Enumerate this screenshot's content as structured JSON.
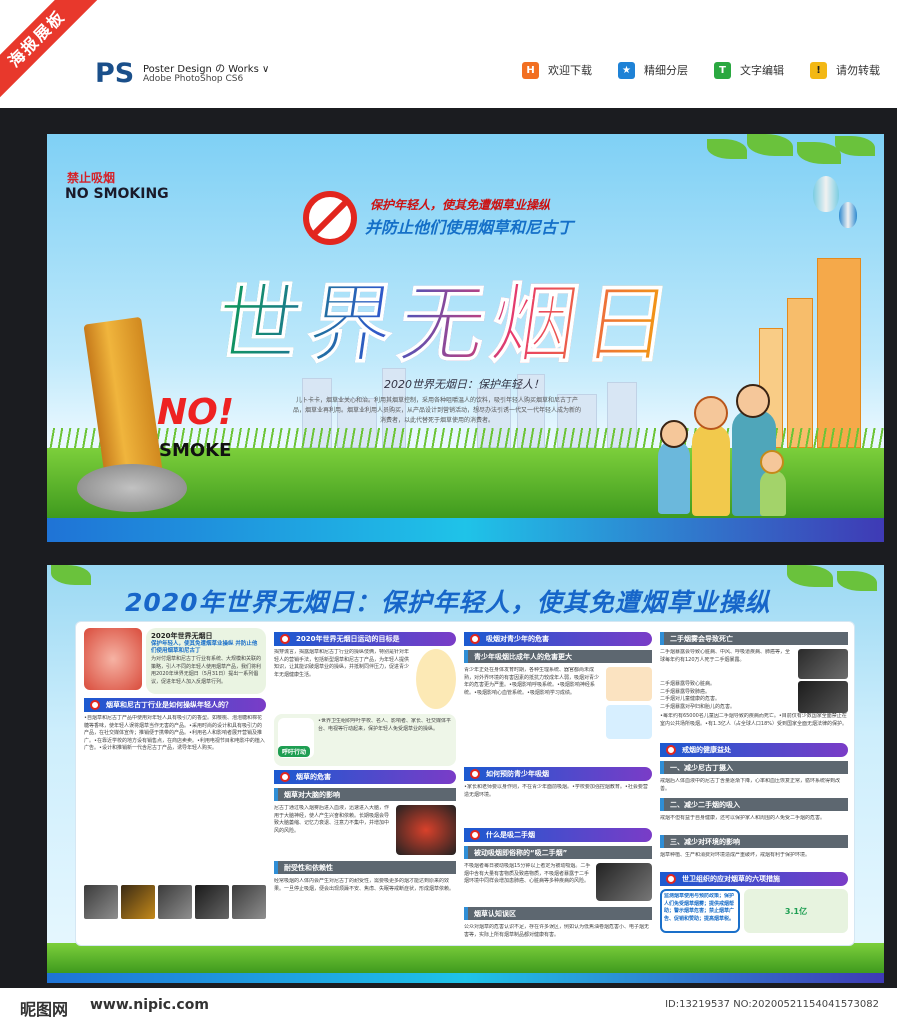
{
  "header": {
    "ribbon": "海报展板",
    "ps_logo": "PS",
    "ps_title": "Poster Design の Works ∨",
    "ps_sub": "Adobe PhotoShop CS6",
    "items": [
      {
        "icon": "H",
        "label": "欢迎下载",
        "color": "#f26f21"
      },
      {
        "icon": "★",
        "label": "精细分层",
        "color": "#1e82d6"
      },
      {
        "icon": "T",
        "label": "文字编辑",
        "color": "#2aa840"
      },
      {
        "icon": "!",
        "label": "请勿转载",
        "color": "#f3b815"
      }
    ]
  },
  "poster_top": {
    "badge_cn": "禁止吸烟",
    "badge_en": "NO SMOKING",
    "sub1": "保护年轻人，使其免遭烟草业操纵",
    "sub2": "并防止他们使用烟草和尼古丁",
    "main_title": "世界无烟日",
    "date_line": "2020世界无烟日：保护年轻人！",
    "intro": "儿卜卡卡，烟草业关心和治。利用其烟草控制，采用各种咀嚼温人的饮料，吸引年轻人购买烟草和尼古丁产品，烟草业再利用。烟草业利用人员购买，从产品设计到营销活动，想尽办法引诱一代又一代年轻人成为新的消费者，以此代替死于烟草使用的消费者。",
    "no_text": "NO!",
    "smoke_text": "SMOKE"
  },
  "poster_bottom": {
    "title": "2020年世界无烟日：保护年轻人，使其免遭烟草业操纵",
    "col1": {
      "box_title": "2020年世界无烟日",
      "box_sub": "保护年轻人，使其免遭烟草业操纵 并防止他们使用烟草和尼古丁",
      "box_text": "为对付烟草和尼古丁行业有系统、大规模和关联的策略，引人不同的年轻人使用烟草产品，我们将利用2020年世界无烟日（5月31日）提出一系列倡议，促进年轻人加入反烟草行列。",
      "sec1": "烟草和尼古丁行业是如何操纵年轻人的？",
      "text1": "•自烟草和尼古丁产品中使用对年轻人具有吸引力的香型。如樱桃、泡泡糖和棉花糖等香味，使年轻人误将烟草当作无害的产品。•采用时尚的设计和具有吸引力的产品，在社交媒体宣传；推销便于携带的产品。•利用名人和影响者展开营销及推广。•在靠近学校的地方设有销售点，在商店卖卖。•利用电视节目和电影中的植入广告。•设计和推销新一代含尼古丁产品，诱导年轻人购买。",
      "photos": [
        "",
        "",
        "",
        "",
        ""
      ]
    },
    "col2": {
      "sec1": "2020年世界无烟日运动的目标是",
      "text1": "揭穿谎言，揭露烟草和尼古丁行业的操纵伎俩，特别是针对年轻人的营销手法，包括新型烟草和尼古丁产品，为年轻人提供知识，让其能识破烟草业的操纵，并抵制同伴压力，促进青少年无烟健康生活。",
      "tag": "呼吁行动",
      "text2": "•世界卫生组织呼吁学校、名人、影响者、家长、社交媒体平台、电视等行动起来，保护年轻人免受烟草业的操纵。",
      "sec2": "烟草的危害",
      "sub1": "烟草对大脑的影响",
      "text3": "尼古丁通过吸入烟雾后进入血液，迅速进入大脑，作用于大脑神经，使人产生兴奋和依赖。长期吸烟会导致大脑萎缩、记忆力衰退、注意力不集中，并增加中风的风险。",
      "sub2": "耐受性和依赖性",
      "text4": "经常吸烟的人体内会产生对尼古丁的耐受性，需要吸更多的烟才能达到原来的效果。一旦停止吸烟，便会出现烦躁不安、焦虑、失眠等戒断症状，形成烟草依赖。"
    },
    "col3": {
      "sec1": "吸烟对青少年的危害",
      "sub1": "青少年吸烟比成年人的危害更大",
      "text1": "青少年正处在身体发育时期，各种生理系统、器官都尚未成熟，对外界环境的有害因素的抵抗力较成年人弱，吸烟对青少年的危害更为严重。•吸烟影响呼吸系统。•吸烟影响神经系统。•吸烟影响心血管系统。•吸烟影响学习成绩。",
      "sec2": "如何预防青少年吸烟",
      "text2": "•家长和老师要以身作则，不在青少年面前吸烟。•学校要加强控烟教育。•社会要营造无烟环境。",
      "sec3": "什么是吸二手烟",
      "sub2": "被动吸烟即俗称的“吸二手烟”",
      "text3": "不吸烟者每日被动吸烟15分钟以上者定为被动吸烟。二手烟中含有大量有害物质及致癌物质，不吸烟者暴露于二手烟环境中同样会增加患肺癌、心脏病等多种疾病的风险。",
      "sub3": "烟草认知误区",
      "text4": "公众对烟草的危害认识不足，存在许多误区，例如认为低焦油卷烟危害小、电子烟无害等，实际上所有烟草制品都对健康有害。"
    },
    "col4": {
      "sub1": "二手烟雾会导致死亡",
      "text1": "二手烟暴露会导致心脏病、中风、呼吸道疾病、肺癌等，全球每年约有120万人死于二手烟暴露。",
      "items": [
        "二手烟暴露导致心脏病。",
        "二手烟暴露导致肺癌。",
        "二手烟对儿童健康的危害。",
        "二手烟暴露对孕妇和胎儿的危害。"
      ],
      "text2": "•每年约有65000名儿童因二手烟导致的疾病而死亡。•目前仅有少数国家全面禁止在室内公共场所吸烟。•有1.3亿人（占全球人口18%）受到国家全面无烟法律的保护。",
      "sec1": "戒烟的健康益处",
      "sub2": "一、减少尼古丁摄入",
      "text3": "戒烟后人体血液中的尼古丁含量逐渐下降，心率和血压恢复正常，循环系统得到改善。",
      "sub3": "二、减少二手烟的吸入",
      "text4": "戒烟不但有益于自身健康，还可以保护家人和周围的人免受二手烟的危害。",
      "sub4": "三、减少对环境的影响",
      "text5": "烟草种植、生产和消费对环境造成严重破坏，戒烟有利于保护环境。",
      "sec2": "世卫组织的应对烟草的六项措施",
      "text6": "监测烟草使用与预防政策；保护人们免受烟草烟雾；提供戒烟帮助；警示烟草危害；禁止烟草广告、促销和赞助；提高烟草税。",
      "logo_text": "3.1亿"
    }
  },
  "footer": {
    "logo": "昵图网",
    "url": "www.nipic.com",
    "id": "ID:13219537 NO:20200521154041573082"
  }
}
